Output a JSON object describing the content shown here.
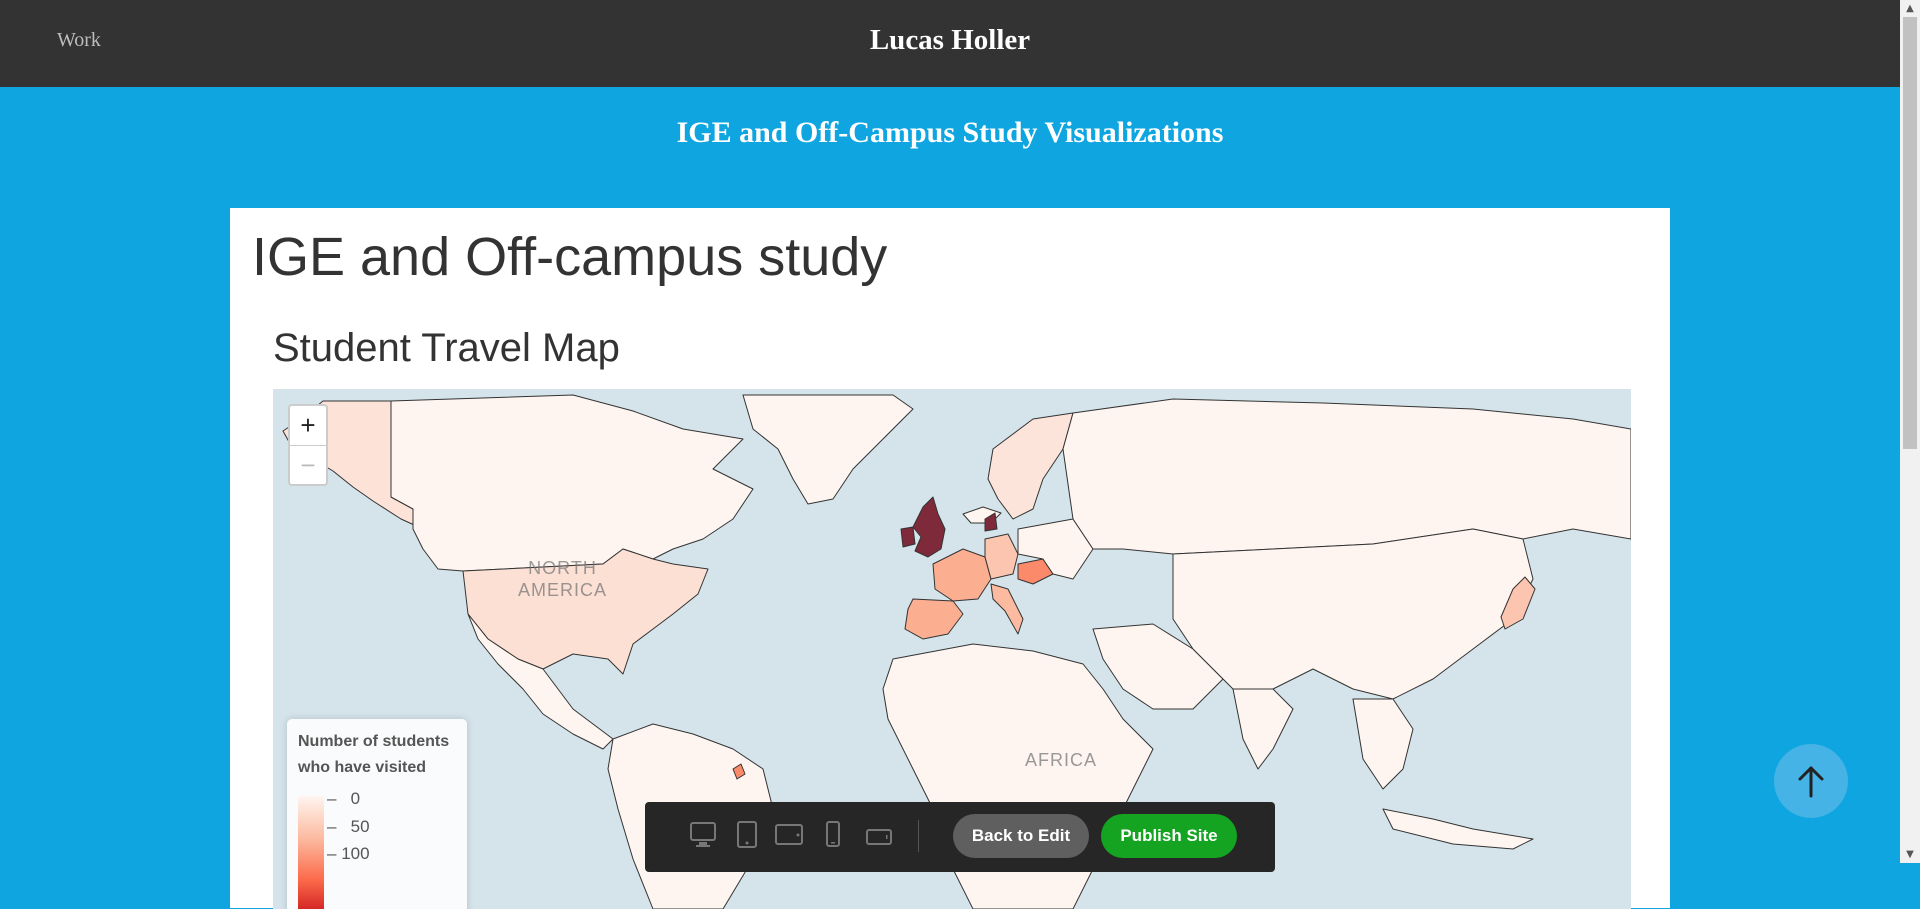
{
  "header": {
    "nav_work": "Work",
    "site_title": "Lucas Holler"
  },
  "page": {
    "heading": "IGE and Off-Campus Study Visualizations"
  },
  "content": {
    "title": "IGE and Off-campus study",
    "map_title": "Student Travel Map"
  },
  "map": {
    "zoom_in": "+",
    "zoom_out": "−",
    "labels": [
      "NORTH",
      "AMERICA",
      "AFRICA"
    ],
    "legend": {
      "title": "Number of students who have visited",
      "ticks": [
        "0",
        "50",
        "100"
      ]
    },
    "colors": {
      "ocean": "#d4e4ea",
      "land_low": "#fff5f0",
      "land_mid": "#fcbba1",
      "land_high": "#fb6a4a",
      "land_max": "#7f2a3a"
    }
  },
  "toolbar": {
    "device_icons": [
      "desktop-icon",
      "tablet-icon",
      "tablet-landscape-icon",
      "phone-icon",
      "phone-landscape-icon"
    ],
    "back_label": "Back to Edit",
    "publish_label": "Publish Site"
  },
  "colors": {
    "header_bg": "#333333",
    "page_bg": "#0ea5e0",
    "publish": "#15a322"
  }
}
